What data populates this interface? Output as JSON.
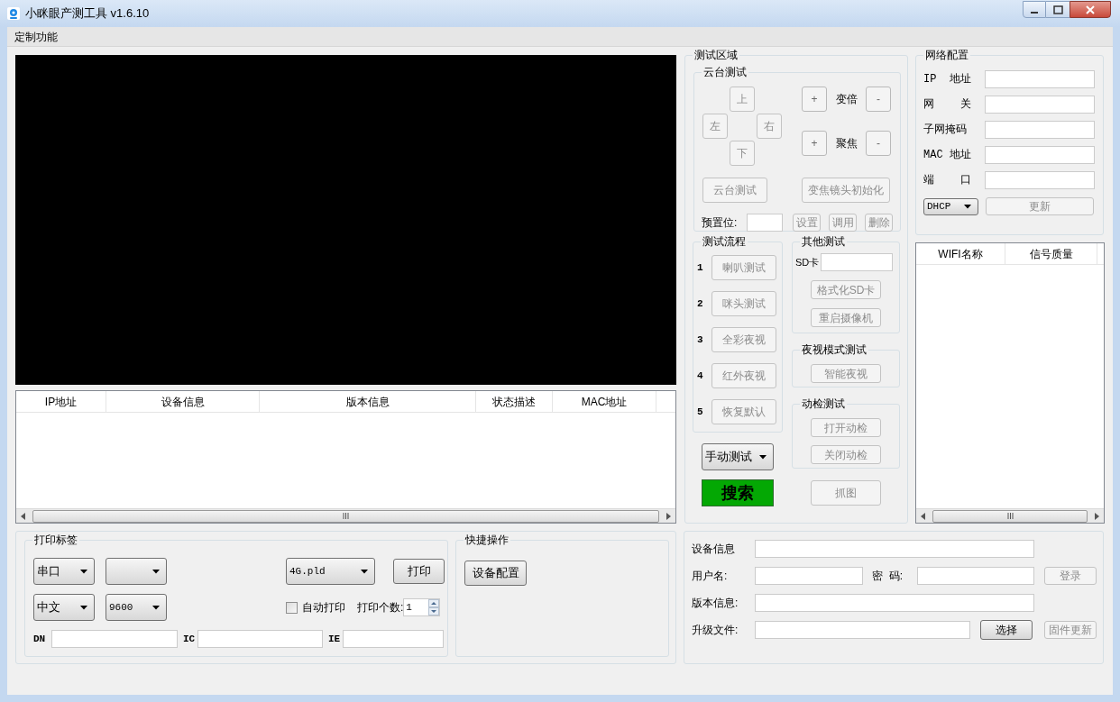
{
  "window": {
    "title": "小眯眼产测工具 v1.6.10"
  },
  "menu": [
    {
      "label": "定制功能"
    }
  ],
  "device_table": {
    "columns": [
      "IP地址",
      "设备信息",
      "版本信息",
      "状态描述",
      "MAC地址"
    ]
  },
  "test_area": {
    "title": "测试区域",
    "ptz": {
      "title": "云台测试",
      "directions": [
        {
          "label": "上",
          "disabled": true
        },
        {
          "label": "左",
          "disabled": true
        },
        {
          "label": "右",
          "disabled": true
        },
        {
          "label": "下",
          "disabled": true
        }
      ],
      "adjust": [
        {
          "label": "变倍",
          "plus": "+",
          "minus": "-"
        },
        {
          "label": "聚焦",
          "plus": "+",
          "minus": "-"
        }
      ],
      "actions": [
        {
          "label": "云台测试",
          "disabled": true
        },
        {
          "label": "变焦镜头初始化",
          "disabled": true
        }
      ],
      "preset_label": "预置位:",
      "preset_buttons": [
        {
          "label": "设置",
          "disabled": true
        },
        {
          "label": "调用",
          "disabled": true
        },
        {
          "label": "删除",
          "disabled": true
        }
      ]
    },
    "flow": {
      "title": "测试流程",
      "steps": [
        {
          "number": "1",
          "label": "喇叭测试",
          "disabled": true
        },
        {
          "number": "2",
          "label": "咪头测试",
          "disabled": true
        },
        {
          "number": "3",
          "label": "全彩夜视",
          "disabled": true
        },
        {
          "number": "4",
          "label": "红外夜视",
          "disabled": true
        },
        {
          "number": "5",
          "label": "恢复默认",
          "disabled": true
        }
      ]
    },
    "other": {
      "title": "其他测试",
      "sd_label": "SD卡",
      "buttons": [
        {
          "label": "格式化SD卡",
          "disabled": true
        },
        {
          "label": "重启摄像机",
          "disabled": true
        }
      ]
    },
    "night": {
      "title": "夜视模式测试",
      "buttons": [
        {
          "label": "智能夜视",
          "disabled": true
        }
      ]
    },
    "motion": {
      "title": "动检测试",
      "buttons": [
        {
          "label": "打开动检",
          "disabled": true
        },
        {
          "label": "关闭动检",
          "disabled": true
        }
      ]
    },
    "mode_select": "手动测试",
    "search_button": "搜索",
    "capture_button": {
      "label": "抓图",
      "disabled": true
    }
  },
  "network": {
    "title": "网络配置",
    "fields": [
      {
        "label": "IP  地址"
      },
      {
        "label": "网    关"
      },
      {
        "label": "子网掩码"
      },
      {
        "label": "MAC 地址"
      },
      {
        "label": "端    口"
      }
    ],
    "mode_select": "DHCP",
    "update_button": {
      "label": "更新",
      "disabled": true
    }
  },
  "wifi_table": {
    "columns": [
      "WIFI名称",
      "信号质量"
    ]
  },
  "print_label": {
    "title": "打印标签",
    "port_select": "串口",
    "language_select": "中文",
    "baud_select": "9600",
    "template_select": "4G.pld",
    "print_button": {
      "label": "打印",
      "disabled": false
    },
    "auto_print": {
      "label": "自动打印",
      "checked": false
    },
    "count_label": "打印个数:",
    "count_value": "1",
    "code_fields": [
      {
        "label": "DN"
      },
      {
        "label": "IC"
      },
      {
        "label": "IE"
      }
    ]
  },
  "quick_ops": {
    "title": "快捷操作",
    "buttons": [
      {
        "label": "设备配置",
        "disabled": false
      }
    ]
  },
  "device_login": {
    "info_label": "设备信息",
    "user_label": "用户名:",
    "password_label": "密  码:",
    "login_button": {
      "label": "登录",
      "disabled": true
    },
    "version_label": "版本信息:",
    "upgrade_label": "升级文件:",
    "choose_button": {
      "label": "选择",
      "disabled": false
    },
    "firmware_button": {
      "label": "固件更新",
      "disabled": true
    }
  }
}
